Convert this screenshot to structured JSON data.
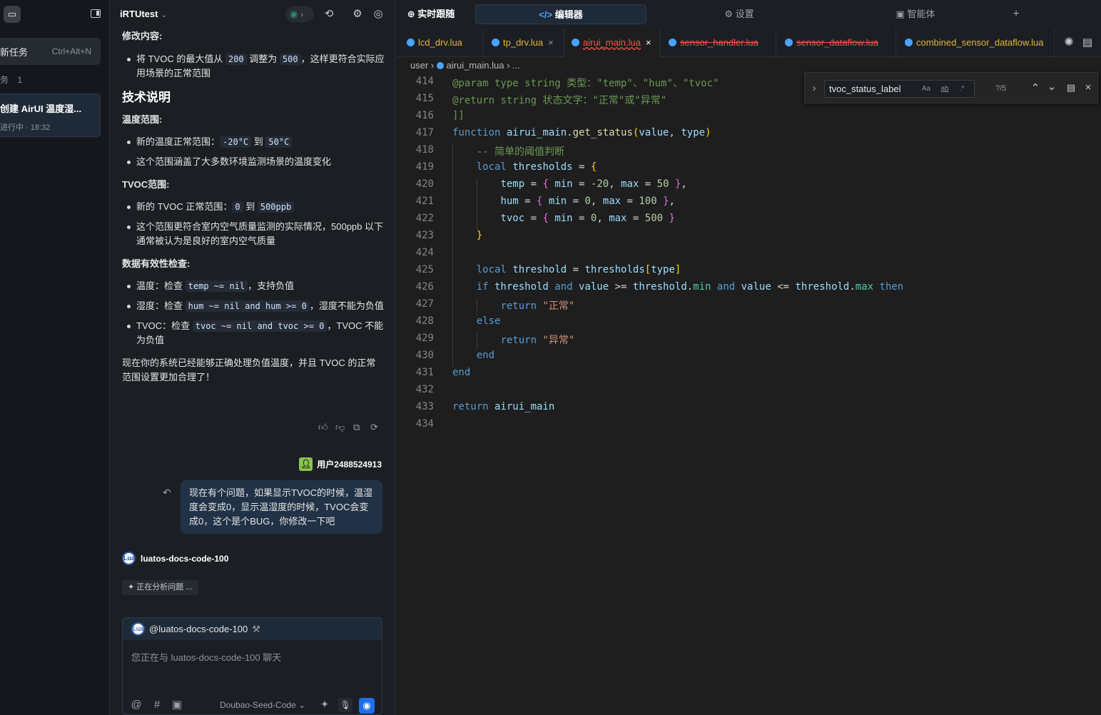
{
  "sidebar": {
    "new_task_label": "新任务",
    "new_task_shortcut": "Ctrl+Alt+N",
    "section_label": "务",
    "section_count": "1",
    "task_title": "创建 AirUI 温度湿...",
    "task_status": "进行中 · 18:32"
  },
  "chat": {
    "project_name": "iRTUtest",
    "changes_heading": "修改内容:",
    "change_item_prefix": "将 TVOC 的最大值从",
    "change_from": "200",
    "change_mid": "调整为",
    "change_to": "500",
    "change_suffix": "，这样更符合实际应用场景的正常范围",
    "tech_heading": "技术说明",
    "temp_heading": "温度范围:",
    "temp_item1_prefix": "新的温度正常范围：",
    "temp_min": "-20°C",
    "temp_to": "到",
    "temp_max": "50°C",
    "temp_item2": "这个范围涵盖了大多数环境监测场景的温度变化",
    "tvoc_heading": "TVOC范围:",
    "tvoc_item1_prefix": "新的 TVOC 正常范围：",
    "tvoc_min": "0",
    "tvoc_to": "到",
    "tvoc_max": "500ppb",
    "tvoc_item2": "这个范围更符合室内空气质量监测的实际情况，500ppb 以下通常被认为是良好的室内空气质量",
    "valid_heading": "数据有效性检查:",
    "valid1_prefix": "温度：检查",
    "valid1_code": "temp ~= nil",
    "valid1_suffix": "，支持负值",
    "valid2_prefix": "湿度：检查",
    "valid2_code": "hum ~= nil and hum >= 0",
    "valid2_suffix": "，湿度不能为负值",
    "valid3_prefix": "TVOC：检查",
    "valid3_code": "tvoc ~= nil and tvoc >= 0",
    "valid3_suffix": "，TVOC 不能为负值",
    "conclusion": "现在你的系统已经能够正确处理负值温度，并且 TVOC 的正常范围设置更加合理了！",
    "user_name": "用户2488524913",
    "user_message": "现在有个问题，如果显示TVOC的时候，温湿度会变成0，显示温湿度的时候，TVOC会变成0，这个是个BUG，你修改一下吧",
    "agent_name": "luatos-docs-code-100",
    "analyzing": "正在分析问题 ...",
    "input_agent": "@luatos-docs-code-100",
    "input_placeholder": "您正在与 luatos-docs-code-100 聊天",
    "model_name": "Doubao-Seed-Code"
  },
  "editor": {
    "top_tabs": [
      {
        "label": "实时跟随"
      },
      {
        "label": "编辑器"
      },
      {
        "label": "设置"
      },
      {
        "label": "智能体"
      }
    ],
    "file_tabs": [
      {
        "label": "lcd_drv.lua"
      },
      {
        "label": "tp_drv.lua"
      },
      {
        "label": "airui_main.lua"
      },
      {
        "label": "sensor_handler.lua"
      },
      {
        "label": "sensor_dataflow.lua"
      },
      {
        "label": "combined_sensor_dataflow.lua"
      }
    ],
    "breadcrumb": {
      "folder": "user",
      "file": "airui_main.lua",
      "more": "..."
    },
    "find": {
      "query": "tvoc_status_label",
      "count": "?/5",
      "opt_case": "Aa",
      "opt_word": "ab",
      "opt_regex": ".*"
    },
    "line_numbers": [
      "414",
      "415",
      "416",
      "417",
      "418",
      "419",
      "420",
      "421",
      "422",
      "423",
      "424",
      "425",
      "426",
      "427",
      "428",
      "429",
      "430",
      "431",
      "432",
      "433",
      "434"
    ],
    "code": {
      "l414_a": "@param",
      "l414_b": " type ",
      "l414_c": "string",
      "l414_d": " 类型：\"temp\"、\"hum\"、\"tvoc\"",
      "l415_a": "@return",
      "l415_b": " string 状态文字：\"正常\"或\"异常\"",
      "l416": "]]",
      "l417_kw": "function",
      "l417_obj": "airui_main",
      "l417_dot": ".",
      "l417_fn": "get_status",
      "l417_p1": "(",
      "l417_a1": "value",
      "l417_c": ", ",
      "l417_a2": "type",
      "l417_p2": ")",
      "l418": "-- 简单的阈值判断",
      "l419_kw": "local",
      "l419_id": "thresholds",
      "l419_op": " = ",
      "l419_br": "{",
      "l420_id": "temp",
      "l420_op": " = ",
      "l420_b1": "{",
      "l420_k1": " min",
      "l420_e1": " = ",
      "l420_v1": "-20",
      "l420_c": ", ",
      "l420_k2": "max",
      "l420_e2": " = ",
      "l420_v2": "50",
      "l420_b2": " }",
      "l420_t": ",",
      "l421_id": "hum",
      "l421_op": " = ",
      "l421_b1": "{",
      "l421_k1": " min",
      "l421_e1": " = ",
      "l421_v1": "0",
      "l421_c": ", ",
      "l421_k2": "max",
      "l421_e2": " = ",
      "l421_v2": "100",
      "l421_b2": " }",
      "l421_t": ",",
      "l422_id": "tvoc",
      "l422_op": " = ",
      "l422_b1": "{",
      "l422_k1": " min",
      "l422_e1": " = ",
      "l422_v1": "0",
      "l422_c": ", ",
      "l422_k2": "max",
      "l422_e2": " = ",
      "l422_v2": "500",
      "l422_b2": " }",
      "l423": "}",
      "l425_kw": "local",
      "l425_id": "threshold",
      "l425_op": " = ",
      "l425_t": "thresholds",
      "l425_b1": "[",
      "l425_k": "type",
      "l425_b2": "]",
      "l426_if": "if",
      "l426_a": " threshold",
      "l426_and1": " and",
      "l426_v": " value",
      "l426_ge": " >= ",
      "l426_t1": "threshold",
      "l426_d1": ".",
      "l426_min": "min",
      "l426_and2": " and",
      "l426_v2": " value",
      "l426_le": " <= ",
      "l426_t2": "threshold",
      "l426_d2": ".",
      "l426_max": "max",
      "l426_then": " then",
      "l427_kw": "return",
      "l427_st": " \"正常\"",
      "l428": "else",
      "l429_kw": "return",
      "l429_st": " \"异常\"",
      "l430": "end",
      "l431": "end",
      "l433_kw": "return",
      "l433_id": " airui_main"
    }
  },
  "colors": {
    "accent": "#1f6feb",
    "modified_tab": "#e3b341",
    "error_tab": "#f85149"
  }
}
